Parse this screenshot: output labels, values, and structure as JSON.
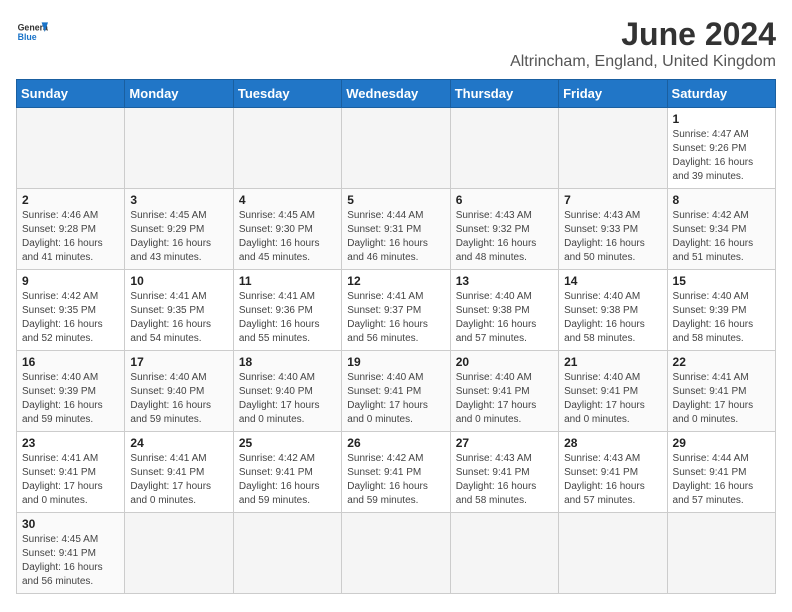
{
  "header": {
    "logo_general": "General",
    "logo_blue": "Blue",
    "title": "June 2024",
    "subtitle": "Altrincham, England, United Kingdom"
  },
  "weekdays": [
    "Sunday",
    "Monday",
    "Tuesday",
    "Wednesday",
    "Thursday",
    "Friday",
    "Saturday"
  ],
  "weeks": [
    [
      {
        "day": "",
        "info": ""
      },
      {
        "day": "",
        "info": ""
      },
      {
        "day": "",
        "info": ""
      },
      {
        "day": "",
        "info": ""
      },
      {
        "day": "",
        "info": ""
      },
      {
        "day": "",
        "info": ""
      },
      {
        "day": "1",
        "info": "Sunrise: 4:47 AM\nSunset: 9:26 PM\nDaylight: 16 hours and 39 minutes."
      }
    ],
    [
      {
        "day": "2",
        "info": "Sunrise: 4:46 AM\nSunset: 9:28 PM\nDaylight: 16 hours and 41 minutes."
      },
      {
        "day": "3",
        "info": "Sunrise: 4:45 AM\nSunset: 9:29 PM\nDaylight: 16 hours and 43 minutes."
      },
      {
        "day": "4",
        "info": "Sunrise: 4:45 AM\nSunset: 9:30 PM\nDaylight: 16 hours and 45 minutes."
      },
      {
        "day": "5",
        "info": "Sunrise: 4:44 AM\nSunset: 9:31 PM\nDaylight: 16 hours and 46 minutes."
      },
      {
        "day": "6",
        "info": "Sunrise: 4:43 AM\nSunset: 9:32 PM\nDaylight: 16 hours and 48 minutes."
      },
      {
        "day": "7",
        "info": "Sunrise: 4:43 AM\nSunset: 9:33 PM\nDaylight: 16 hours and 50 minutes."
      },
      {
        "day": "8",
        "info": "Sunrise: 4:42 AM\nSunset: 9:34 PM\nDaylight: 16 hours and 51 minutes."
      }
    ],
    [
      {
        "day": "9",
        "info": "Sunrise: 4:42 AM\nSunset: 9:35 PM\nDaylight: 16 hours and 52 minutes."
      },
      {
        "day": "10",
        "info": "Sunrise: 4:41 AM\nSunset: 9:35 PM\nDaylight: 16 hours and 54 minutes."
      },
      {
        "day": "11",
        "info": "Sunrise: 4:41 AM\nSunset: 9:36 PM\nDaylight: 16 hours and 55 minutes."
      },
      {
        "day": "12",
        "info": "Sunrise: 4:41 AM\nSunset: 9:37 PM\nDaylight: 16 hours and 56 minutes."
      },
      {
        "day": "13",
        "info": "Sunrise: 4:40 AM\nSunset: 9:38 PM\nDaylight: 16 hours and 57 minutes."
      },
      {
        "day": "14",
        "info": "Sunrise: 4:40 AM\nSunset: 9:38 PM\nDaylight: 16 hours and 58 minutes."
      },
      {
        "day": "15",
        "info": "Sunrise: 4:40 AM\nSunset: 9:39 PM\nDaylight: 16 hours and 58 minutes."
      }
    ],
    [
      {
        "day": "16",
        "info": "Sunrise: 4:40 AM\nSunset: 9:39 PM\nDaylight: 16 hours and 59 minutes."
      },
      {
        "day": "17",
        "info": "Sunrise: 4:40 AM\nSunset: 9:40 PM\nDaylight: 16 hours and 59 minutes."
      },
      {
        "day": "18",
        "info": "Sunrise: 4:40 AM\nSunset: 9:40 PM\nDaylight: 17 hours and 0 minutes."
      },
      {
        "day": "19",
        "info": "Sunrise: 4:40 AM\nSunset: 9:41 PM\nDaylight: 17 hours and 0 minutes."
      },
      {
        "day": "20",
        "info": "Sunrise: 4:40 AM\nSunset: 9:41 PM\nDaylight: 17 hours and 0 minutes."
      },
      {
        "day": "21",
        "info": "Sunrise: 4:40 AM\nSunset: 9:41 PM\nDaylight: 17 hours and 0 minutes."
      },
      {
        "day": "22",
        "info": "Sunrise: 4:41 AM\nSunset: 9:41 PM\nDaylight: 17 hours and 0 minutes."
      }
    ],
    [
      {
        "day": "23",
        "info": "Sunrise: 4:41 AM\nSunset: 9:41 PM\nDaylight: 17 hours and 0 minutes."
      },
      {
        "day": "24",
        "info": "Sunrise: 4:41 AM\nSunset: 9:41 PM\nDaylight: 17 hours and 0 minutes."
      },
      {
        "day": "25",
        "info": "Sunrise: 4:42 AM\nSunset: 9:41 PM\nDaylight: 16 hours and 59 minutes."
      },
      {
        "day": "26",
        "info": "Sunrise: 4:42 AM\nSunset: 9:41 PM\nDaylight: 16 hours and 59 minutes."
      },
      {
        "day": "27",
        "info": "Sunrise: 4:43 AM\nSunset: 9:41 PM\nDaylight: 16 hours and 58 minutes."
      },
      {
        "day": "28",
        "info": "Sunrise: 4:43 AM\nSunset: 9:41 PM\nDaylight: 16 hours and 57 minutes."
      },
      {
        "day": "29",
        "info": "Sunrise: 4:44 AM\nSunset: 9:41 PM\nDaylight: 16 hours and 57 minutes."
      }
    ],
    [
      {
        "day": "30",
        "info": "Sunrise: 4:45 AM\nSunset: 9:41 PM\nDaylight: 16 hours and 56 minutes."
      },
      {
        "day": "",
        "info": ""
      },
      {
        "day": "",
        "info": ""
      },
      {
        "day": "",
        "info": ""
      },
      {
        "day": "",
        "info": ""
      },
      {
        "day": "",
        "info": ""
      },
      {
        "day": "",
        "info": ""
      }
    ]
  ]
}
